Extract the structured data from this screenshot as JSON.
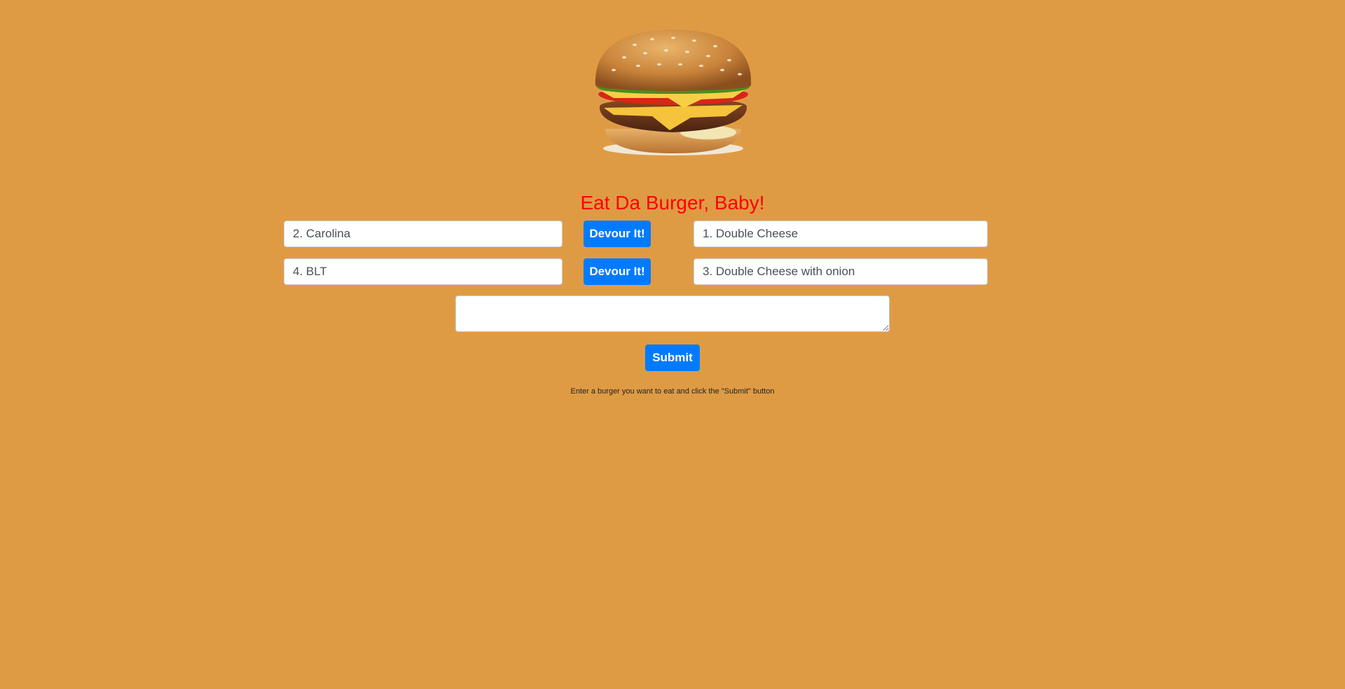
{
  "page": {
    "background_color": "#df9b44",
    "title": "Eat Da Burger, Baby!",
    "title_color": "#ff0000",
    "logo_icon": "burger-icon"
  },
  "burgers": {
    "available": [
      {
        "name": "2. Carolina",
        "devour_label": "Devour It!"
      },
      {
        "name": "4. BLT",
        "devour_label": "Devour It!"
      }
    ],
    "devoured": [
      {
        "name": "1. Double Cheese"
      },
      {
        "name": "3. Double Cheese with onion"
      }
    ]
  },
  "form": {
    "textarea_value": "",
    "submit_label": "Submit",
    "hint": "Enter a burger you want to eat and click the \"Submit\" button",
    "button_color": "#007bff"
  }
}
